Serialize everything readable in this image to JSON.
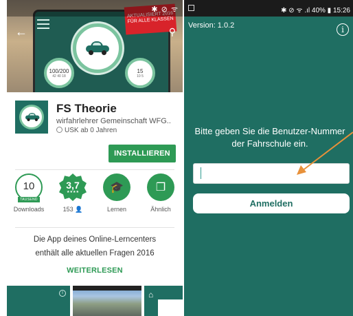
{
  "left_phone": {
    "hero": {
      "banner_text": "AKTUALISIERT 2016 FÜR ALLE KLASSEN",
      "gauge_left": {
        "value": "100/200",
        "sub": "42 40 18"
      },
      "gauge_right": {
        "value": "15",
        "sub": "10 5"
      }
    },
    "app": {
      "title": "FS Theorie",
      "developer": "wirfahrlehrer Gemeinschaft WFG..",
      "age_rating": "USK ab 0 Jahren",
      "install_label": "INSTALLIEREN"
    },
    "stats": [
      {
        "value": "10",
        "tag": "TAUSEND",
        "label": "Downloads"
      },
      {
        "value": "3,7",
        "stars": "★★★★",
        "label": "153"
      },
      {
        "label": "Lernen"
      },
      {
        "label": "Ähnlich"
      }
    ],
    "description_line1": "Die App deines Online-Lerncenters",
    "description_line2": "enthält alle aktuellen Fragen 2016",
    "read_more": "WEITERLESEN"
  },
  "right_phone": {
    "status_text": "✱ ⊘ ᯤ .ıl 40% ▮ 15:26",
    "version": "Version: 1.0.2",
    "prompt": "Bitte geben Sie die Benutzer-Nummer der Fahrschule ein.",
    "input_value": "",
    "input_placeholder": "",
    "login_label": "Anmelden"
  },
  "colors": {
    "teal": "#1f6e62",
    "green": "#2e9a55",
    "gauge_ring": "#7bc49f",
    "arrow": "#e8913a"
  }
}
